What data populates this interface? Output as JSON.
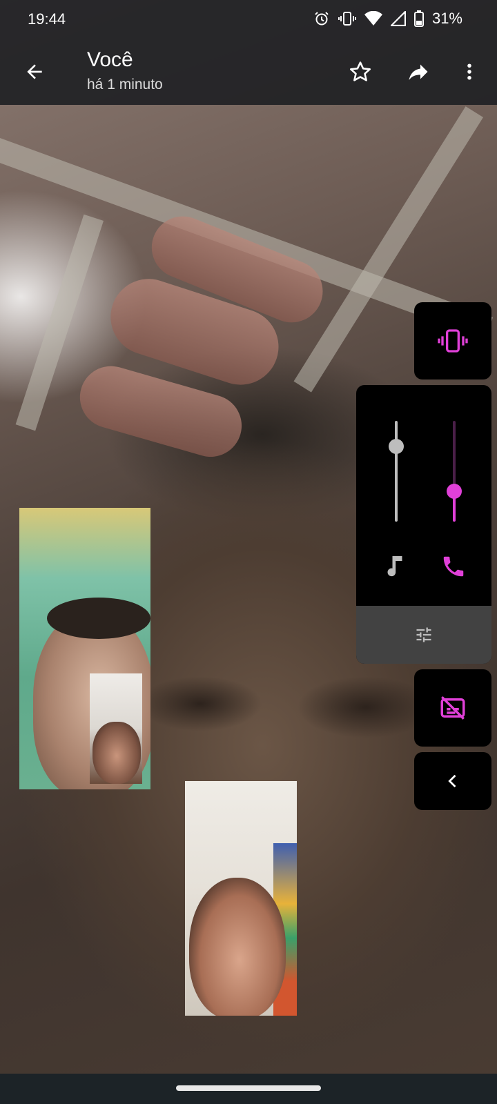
{
  "status_bar": {
    "time": "19:44",
    "battery": "31%",
    "icons": [
      "alarm-icon",
      "vibrate-icon",
      "wifi-icon",
      "signal-icon",
      "battery-icon"
    ]
  },
  "app_bar": {
    "title": "Você",
    "subtitle": "há 1 minuto",
    "actions": [
      "star-icon",
      "share-icon",
      "more-vert-icon"
    ]
  },
  "volume_panel": {
    "ringer_mode_icon": "vibrate-icon",
    "media_level": 0.75,
    "call_level": 0.3,
    "media_icon": "music-note-icon",
    "call_icon": "phone-icon",
    "settings_icon": "tune-icon",
    "captions_icon": "captions-off-icon",
    "collapse_icon": "chevron-left-icon"
  },
  "colors": {
    "accent": "#e040d8",
    "panel_bg": "#000000",
    "panel_settings_bg": "#424242",
    "slider_gray": "#bdbdbd"
  }
}
